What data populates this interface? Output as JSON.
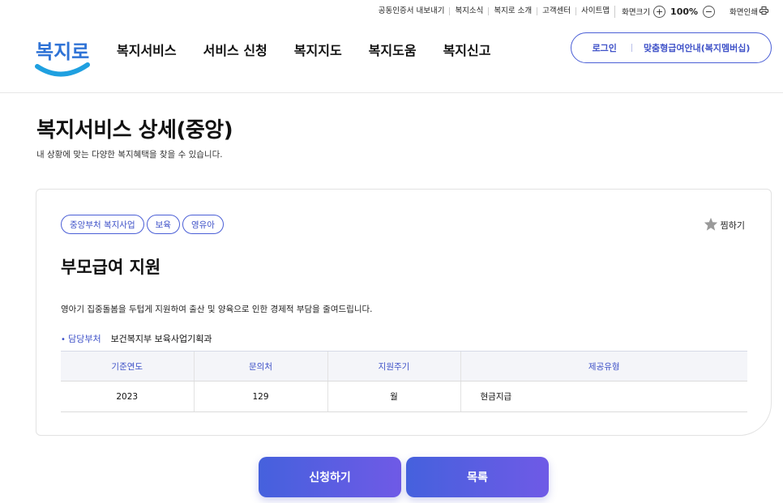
{
  "util_links": [
    "공동인증서 내보내기",
    "복지소식",
    "복지로 소개",
    "고객센터",
    "사이트맵"
  ],
  "zoom": {
    "label": "화면크기",
    "plus": "+",
    "value": "100%",
    "minus": "−"
  },
  "print_label": "화면인쇄",
  "logo_text": "복지로",
  "gnb": [
    "복지서비스",
    "서비스 신청",
    "복지지도",
    "복지도움",
    "복지신고"
  ],
  "login": {
    "login_label": "로그인",
    "membership_label": "맞춤형급여안내(복지멤버십)"
  },
  "page": {
    "title": "복지서비스 상세(중앙)",
    "description": "내 상황에 맞는 다양한 복지혜택을 찾을 수 있습니다."
  },
  "service": {
    "tags": [
      "중앙부처 복지사업",
      "보육",
      "영유아"
    ],
    "favorite_label": "찜하기",
    "title": "부모급여 지원",
    "description": "영아기 집중돌봄을 두텁게 지원하여 출산 및 양육으로 인한 경제적 부담을 줄여드립니다.",
    "dept_label": "담당부처",
    "dept_value": "보건복지부 보육사업기획과",
    "table": {
      "headers": [
        "기준연도",
        "문의처",
        "지원주기",
        "제공유형"
      ],
      "row": [
        "2023",
        "129",
        "월",
        "현금지급"
      ]
    }
  },
  "buttons": {
    "apply": "신청하기",
    "list": "목록"
  },
  "colors": {
    "accent": "#4b5fd6",
    "button_start": "#4561dd",
    "button_end": "#6f5ae6"
  }
}
